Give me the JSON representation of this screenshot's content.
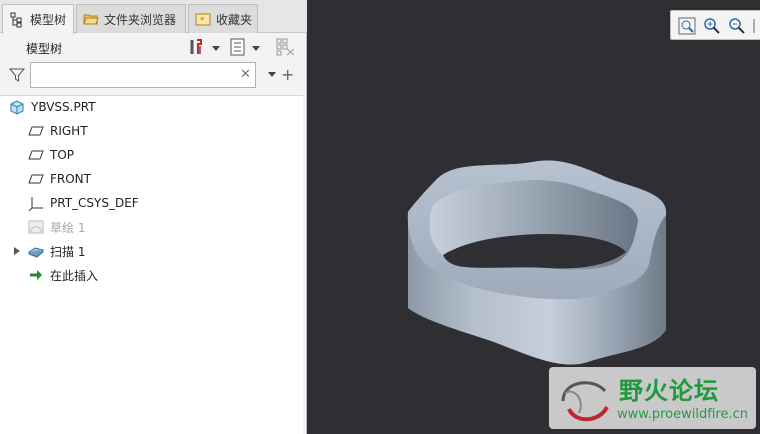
{
  "tabs": [
    {
      "label": "模型树",
      "icon": "tree-icon"
    },
    {
      "label": "文件夹浏览器",
      "icon": "folder-icon"
    },
    {
      "label": "收藏夹",
      "icon": "favorites-icon"
    }
  ],
  "panel": {
    "title": "模型树"
  },
  "search": {
    "value": "",
    "placeholder": ""
  },
  "tree": [
    {
      "label": "YBVSS.PRT",
      "icon": "part-icon"
    },
    {
      "label": "RIGHT",
      "icon": "datum-plane-icon"
    },
    {
      "label": "TOP",
      "icon": "datum-plane-icon"
    },
    {
      "label": "FRONT",
      "icon": "datum-plane-icon"
    },
    {
      "label": "PRT_CSYS_DEF",
      "icon": "csys-icon"
    },
    {
      "label": "草绘 1",
      "icon": "sketch-icon"
    },
    {
      "label": "扫描 1",
      "icon": "sweep-icon"
    },
    {
      "label": "在此插入",
      "icon": "insert-arrow-icon"
    }
  ],
  "watermark": {
    "title": "野火论坛",
    "url": "www.proewildfire.cn"
  },
  "colors": {
    "viewport_bg": "#2e2e33",
    "model": "#9aa6b5",
    "watermark_green": "#1e9a3c"
  }
}
